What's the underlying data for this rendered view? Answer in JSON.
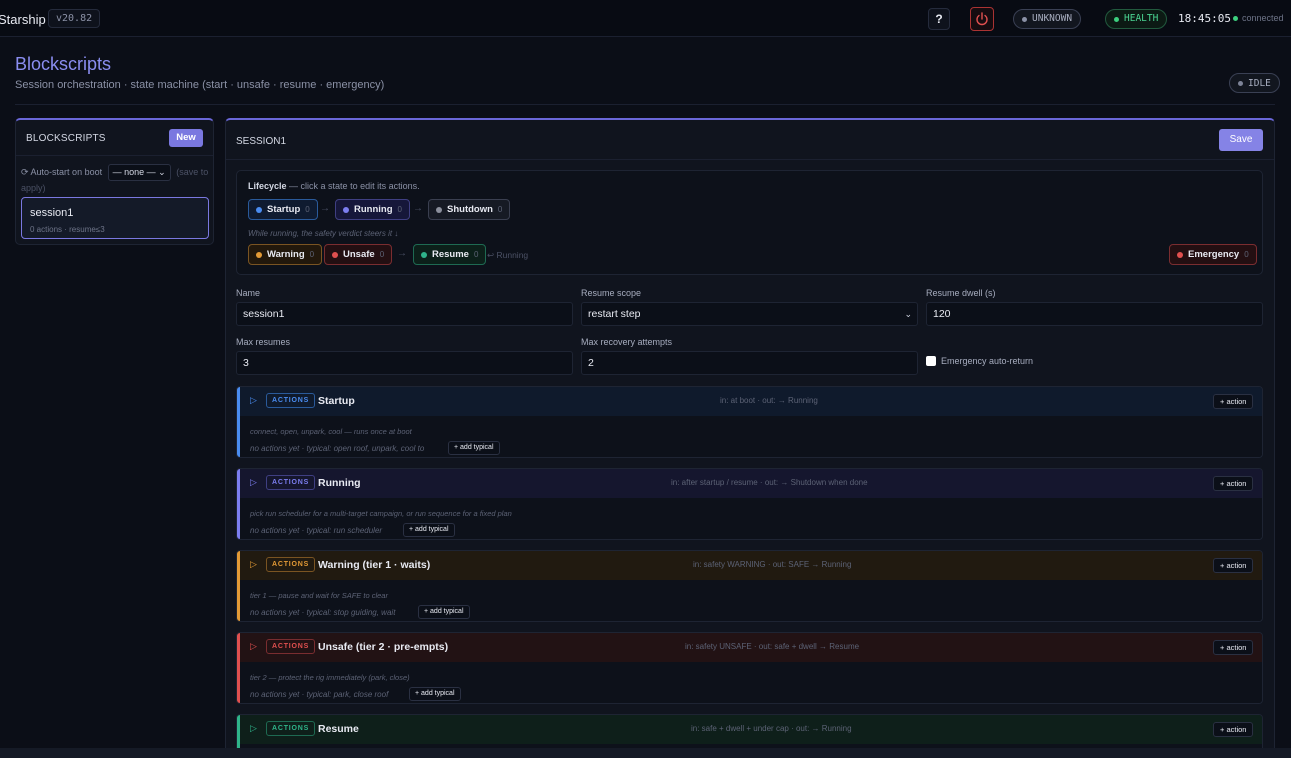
{
  "topbar": {
    "brand": "Starship",
    "version": "v20.82",
    "help_label": "?",
    "status_unknown": "UNKNOWN",
    "status_health": "HEALTH",
    "clock": "18:45:05",
    "connection": "connected"
  },
  "page": {
    "title": "Blockscripts",
    "subtitle": "Session orchestration · state machine (start · unsafe · resume · emergency)",
    "state": "IDLE"
  },
  "left": {
    "heading": "BLOCKSCRIPTS",
    "new_label": "New",
    "autostart_label": "⟳ Auto-start on boot",
    "autostart_value": "— none —",
    "autostart_hint": "(save to apply)",
    "session": {
      "name": "session1",
      "meta": "0 actions · resume≤3"
    }
  },
  "main": {
    "title": "SESSION1",
    "save_label": "Save",
    "lifecycle": {
      "heading": "Lifecycle",
      "hint": "— click a state to edit its actions.",
      "note": "While running, the safety verdict steers it ↓",
      "returns": "↩ Running",
      "states": [
        {
          "label": "Startup",
          "count": "0",
          "color": "#4a8cf0"
        },
        {
          "label": "Running",
          "count": "0",
          "color": "#7c7ef0"
        },
        {
          "label": "Shutdown",
          "count": "0",
          "color": "#8b8f9c"
        },
        {
          "label": "Warning",
          "count": "0",
          "color": "#e39a36"
        },
        {
          "label": "Unsafe",
          "count": "0",
          "color": "#e0504f"
        },
        {
          "label": "Resume",
          "count": "0",
          "color": "#2fb48a"
        },
        {
          "label": "Emergency",
          "count": "0",
          "color": "#e0504f"
        }
      ]
    },
    "fields": {
      "name_label": "Name",
      "name_value": "session1",
      "scope_label": "Resume scope",
      "scope_value": "restart step",
      "dwell_label": "Resume dwell (s)",
      "dwell_value": "120",
      "maxres_label": "Max resumes",
      "maxres_value": "3",
      "maxrec_label": "Max recovery attempts",
      "maxrec_value": "2",
      "emerg_label": "Emergency auto-return"
    },
    "sections": [
      {
        "tag": "ACTIONS",
        "name": "Startup",
        "io": "in: at boot · out: → Running",
        "desc": "connect, open, unpark, cool — runs once at boot",
        "none": "no actions yet · typical: open roof, unpark, cool to",
        "typical": "+ add typical",
        "action": "+ action"
      },
      {
        "tag": "ACTIONS",
        "name": "Running",
        "io": "in: after startup / resume · out: → Shutdown when done",
        "desc": "pick run scheduler for a multi-target campaign, or run sequence for a fixed plan",
        "none": "no actions yet · typical: run scheduler",
        "typical": "+ add typical",
        "action": "+ action"
      },
      {
        "tag": "ACTIONS",
        "name": "Warning (tier 1 · waits)",
        "io": "in: safety WARNING · out: SAFE → Running",
        "desc": "tier 1 — pause and wait for SAFE to clear",
        "none": "no actions yet · typical: stop guiding, wait",
        "typical": "+ add typical",
        "action": "+ action"
      },
      {
        "tag": "ACTIONS",
        "name": "Unsafe (tier 2 · pre-empts)",
        "io": "in: safety UNSAFE · out: safe + dwell → Resume",
        "desc": "tier 2 — protect the rig immediately (park, close)",
        "none": "no actions yet · typical: park, close roof",
        "typical": "+ add typical",
        "action": "+ action"
      },
      {
        "tag": "ACTIONS",
        "name": "Resume",
        "io": "in: safe + dwell + under cap · out: → Running",
        "desc": "",
        "none": "",
        "typical": "",
        "action": "+ action"
      }
    ]
  },
  "colors": {
    "accent": "#7a78e0",
    "startup": "#4a8cf0",
    "running": "#7c7ef0",
    "warning": "#e39a36",
    "unsafe": "#e0504f",
    "resume": "#2fb48a"
  }
}
